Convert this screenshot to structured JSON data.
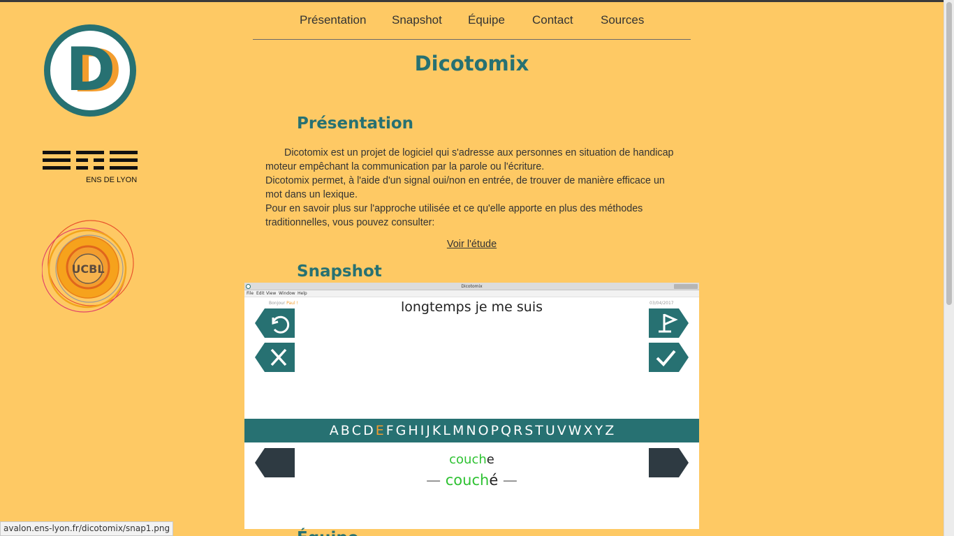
{
  "nav": {
    "items": [
      {
        "label": "Présentation"
      },
      {
        "label": "Snapshot"
      },
      {
        "label": "Équipe"
      },
      {
        "label": "Contact"
      },
      {
        "label": "Sources"
      }
    ]
  },
  "logos": {
    "dicotomix_letter": "D",
    "ens_caption": "ENS DE LYON",
    "ucbl_letters": "UCBL"
  },
  "site_title": "Dicotomix",
  "presentation": {
    "heading": "Présentation",
    "paragraphs": [
      "Dicotomix est un projet de logiciel qui s'adresse aux personnes en situation de handicap moteur empêchant la communication par la parole ou l'écriture.",
      "Dicotomix permet, à l'aide d'un signal oui/non en entrée, de trouver de manière efficace un mot dans un lexique.",
      "Pour en savoir plus sur l'approche utilisée et ce qu'elle apporte en plus des méthodes traditionnelles, vous pouvez consulter:"
    ],
    "link": "Voir l'étude"
  },
  "snapshot": {
    "heading": "Snapshot",
    "window_title": "Dicotomix",
    "menu": [
      "File",
      "Edit",
      "View",
      "Window",
      "Help"
    ],
    "greeting": "Bonjour",
    "user_name": "Paul !",
    "date": "03/04/2017",
    "phrase": "longtemps je me suis",
    "letters": [
      "A",
      "B",
      "C",
      "D",
      "E",
      "F",
      "G",
      "H",
      "I",
      "J",
      "K",
      "L",
      "M",
      "N",
      "O",
      "P",
      "Q",
      "R",
      "S",
      "T",
      "U",
      "V",
      "W",
      "X",
      "Y",
      "Z"
    ],
    "active_letter": "E",
    "word1": {
      "match": "couch",
      "rest": "e"
    },
    "word2": {
      "dash": "—",
      "match": "couch",
      "rest": "é"
    },
    "buttons": [
      "undo-icon",
      "cross-icon",
      "flag-icon",
      "check-icon"
    ]
  },
  "next_heading": "Équipe",
  "status_url": "avalon.ens-lyon.fr/dicotomix/snap1.png",
  "colors": {
    "background": "#fec964",
    "teal": "#277172",
    "orange": "#f39d2e",
    "green": "#2ec232",
    "dark_button": "#2e3a42"
  }
}
